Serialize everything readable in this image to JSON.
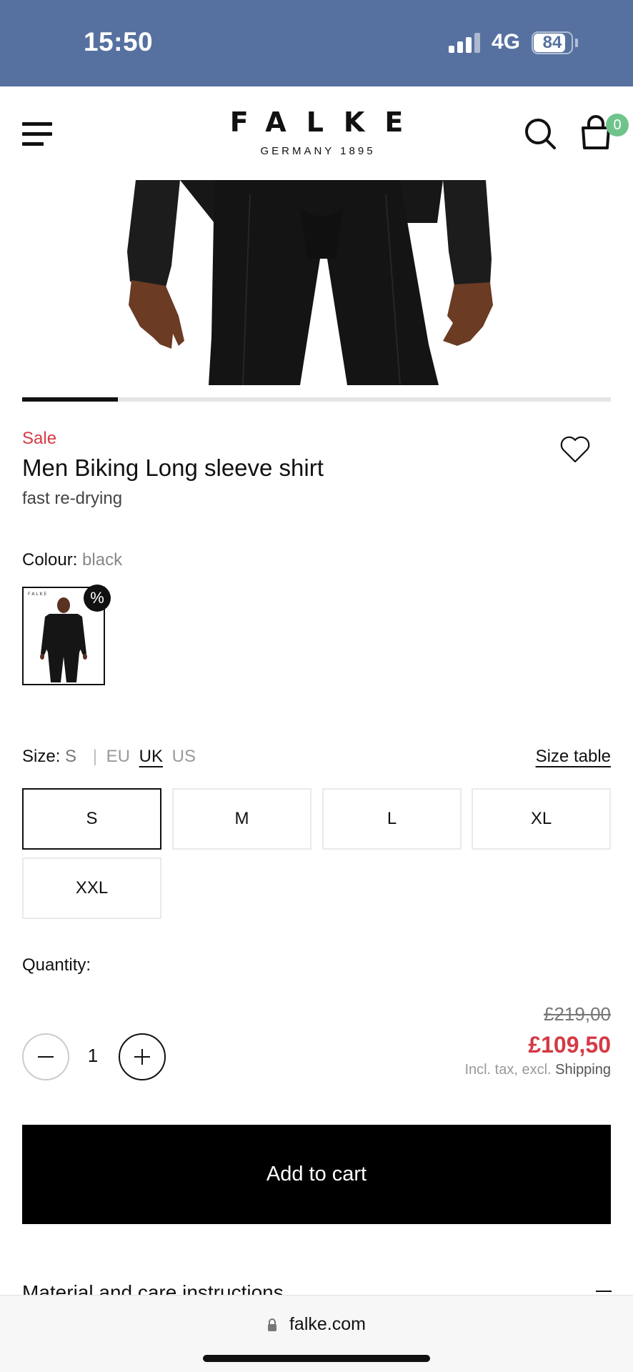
{
  "status_bar": {
    "time": "15:50",
    "network": "4G",
    "battery": "84",
    "battery_level": 0.84
  },
  "header": {
    "logo_main": "FALKE",
    "logo_sub": "GERMANY 1895",
    "cart_count": "0",
    "icons": {
      "menu": "hamburger-menu-icon",
      "search": "search-icon",
      "cart": "shopping-bag-icon"
    }
  },
  "gallery": {
    "progress": 0.163
  },
  "product": {
    "sale_label": "Sale",
    "title": "Men Biking Long sleeve shirt",
    "subtitle": "fast re-drying",
    "colour_label": "Colour:",
    "colour_value": "black",
    "swatch_badge": "%"
  },
  "size": {
    "label": "Size:",
    "selected": "S",
    "separator": "|",
    "units": [
      "EU",
      "UK",
      "US"
    ],
    "active_unit": "UK",
    "size_table_label": "Size table",
    "options": [
      "S",
      "M",
      "L",
      "XL",
      "XXL"
    ]
  },
  "quantity": {
    "label": "Quantity:",
    "value": "1"
  },
  "price": {
    "old": "£219,00",
    "new": "£109,50",
    "note_prefix": "Incl. tax, excl.",
    "note_link": "Shipping"
  },
  "actions": {
    "add_to_cart": "Add to cart"
  },
  "accordion": {
    "title": "Material and care instructions"
  },
  "browser": {
    "url": "falke.com"
  },
  "colors": {
    "accent_sale": "#d43a45",
    "status_bar": "#5671a0",
    "cart_badge": "#6fc48b"
  }
}
